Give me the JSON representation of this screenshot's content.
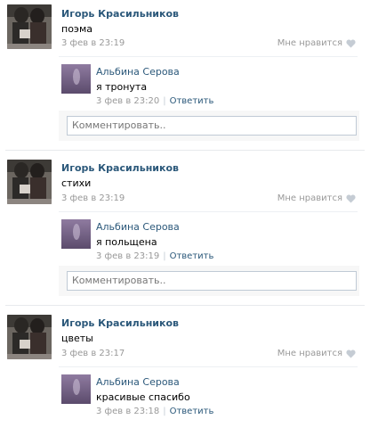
{
  "posts": [
    {
      "author": "Игорь Красильников",
      "text": "поэма",
      "date": "3 фев в 23:19",
      "like_label": "Мне нравится",
      "reply": {
        "author": "Альбина Серова",
        "text": "я тронута",
        "date": "3 фев в 23:20",
        "separator": "|",
        "reply_label": "Ответить"
      },
      "comment_placeholder": "Комментировать.."
    },
    {
      "author": "Игорь Красильников",
      "text": "стихи",
      "date": "3 фев в 23:19",
      "like_label": "Мне нравится",
      "reply": {
        "author": "Альбина Серова",
        "text": "я польщена",
        "date": "3 фев в 23:19",
        "separator": "|",
        "reply_label": "Ответить"
      },
      "comment_placeholder": "Комментировать.."
    },
    {
      "author": "Игорь Красильников",
      "text": "цветы",
      "date": "3 фев в 23:17",
      "like_label": "Мне нравится",
      "reply": {
        "author": "Альбина Серова",
        "text": "красивые спасибо",
        "date": "3 фев в 23:18",
        "separator": "|",
        "reply_label": "Ответить"
      }
    }
  ],
  "icons": {
    "like": "heart-icon"
  },
  "colors": {
    "link": "#2b587a",
    "meta": "#999999",
    "border": "#c0cad5"
  }
}
